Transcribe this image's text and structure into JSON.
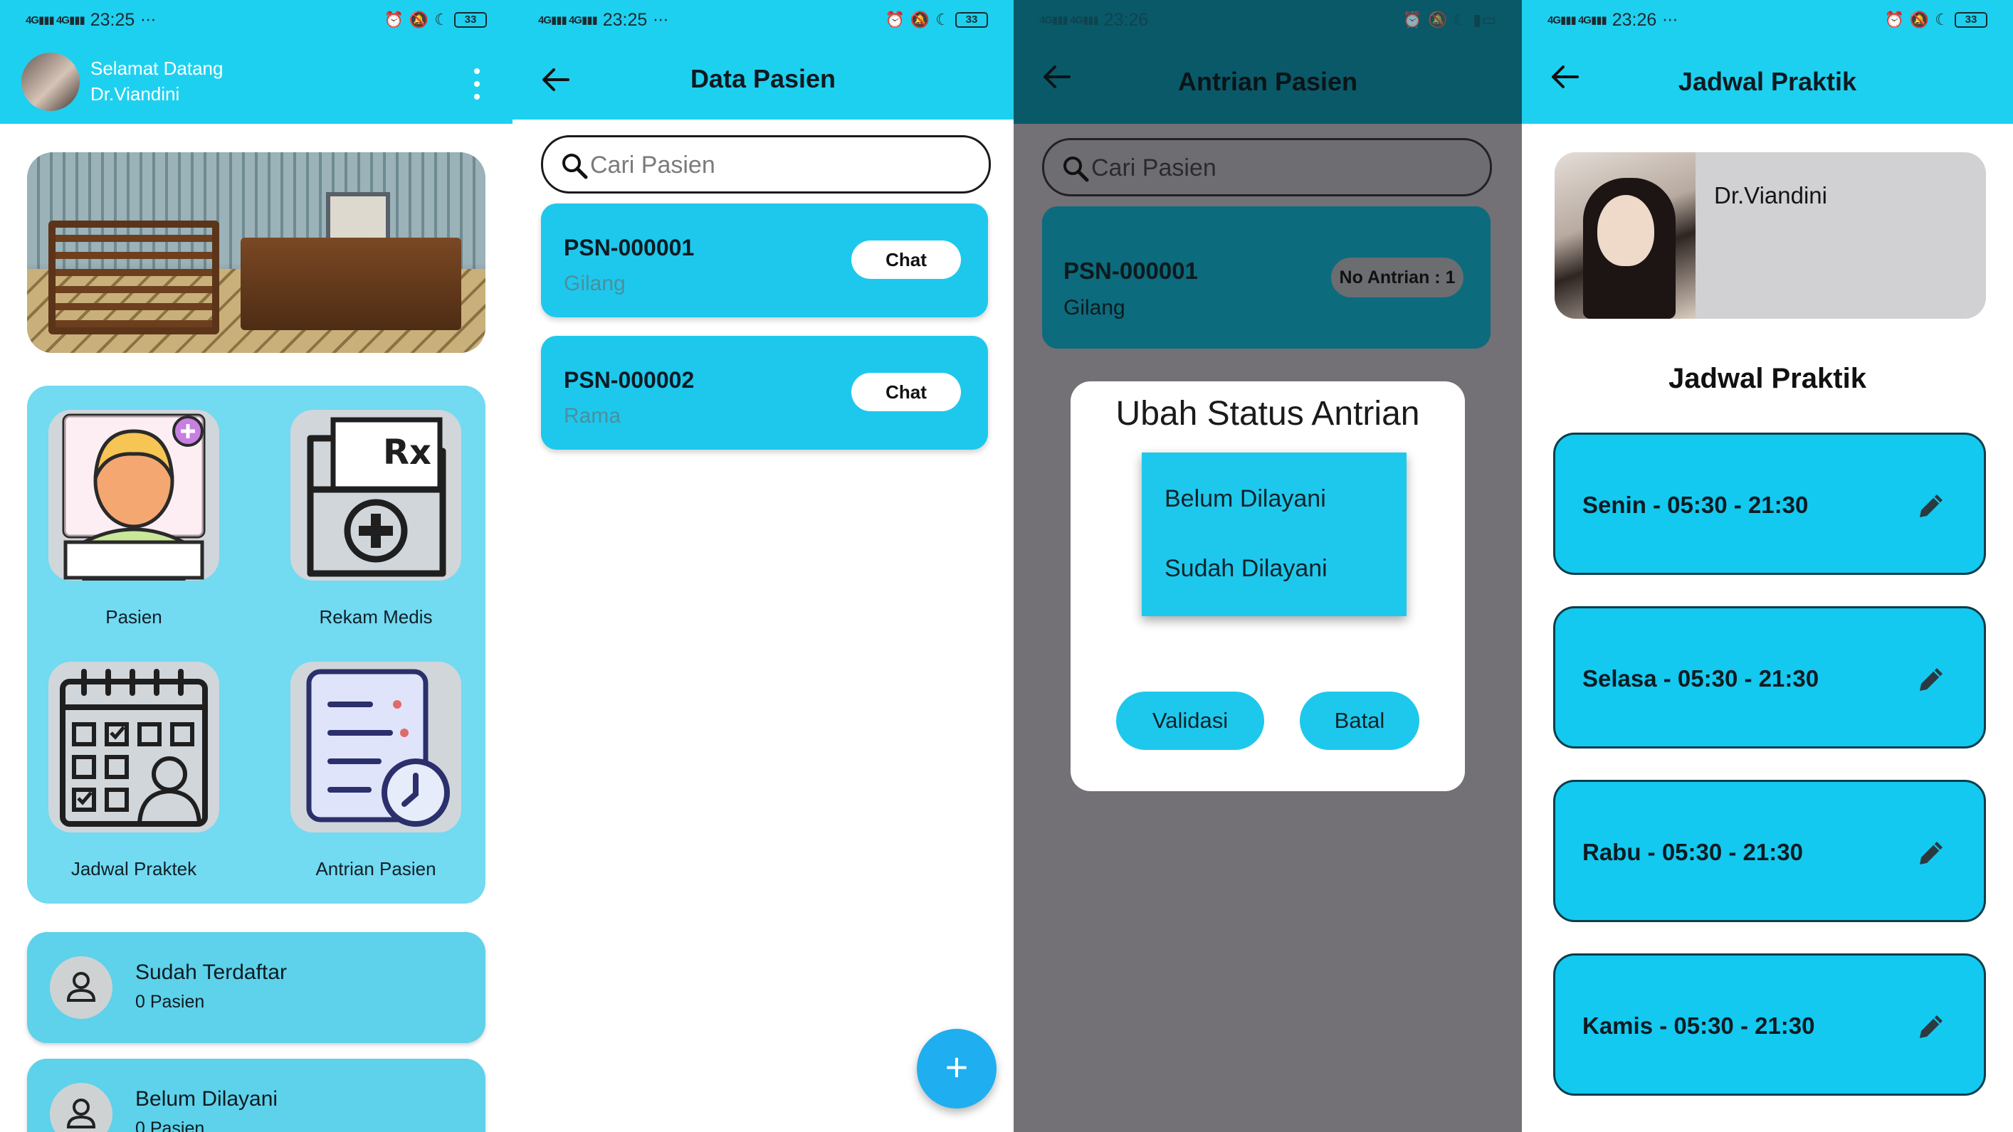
{
  "colors": {
    "primary": "#1ed0ef",
    "card": "#1ec8ec",
    "fab": "#1faef0",
    "overlay": "#737076"
  },
  "status_bars": [
    {
      "time": "23:25",
      "battery": "33"
    },
    {
      "time": "23:25",
      "battery": "33"
    },
    {
      "time": "23:26",
      "battery": ""
    },
    {
      "time": "23:26",
      "battery": "33"
    }
  ],
  "home": {
    "welcome_line1": "Selamat Datang",
    "welcome_line2": "Dr.Viandini",
    "menu": [
      {
        "label": "Pasien",
        "icon": "patient-icon"
      },
      {
        "label": "Rekam Medis",
        "icon": "medical-record-folder-icon"
      },
      {
        "label": "Jadwal Praktek",
        "icon": "calendar-doctor-icon"
      },
      {
        "label": "Antrian Pasien",
        "icon": "queue-clipboard-clock-icon"
      }
    ],
    "stats": [
      {
        "title": "Sudah Terdaftar",
        "subtitle": "0 Pasien"
      },
      {
        "title": "Belum Dilayani",
        "subtitle": "0 Pasien"
      }
    ]
  },
  "data_pasien": {
    "title": "Data Pasien",
    "search_placeholder": "Cari Pasien",
    "patients": [
      {
        "id": "PSN-000001",
        "name": "Gilang",
        "action": "Chat"
      },
      {
        "id": "PSN-000002",
        "name": "Rama",
        "action": "Chat"
      }
    ],
    "fab": "+"
  },
  "antrian": {
    "title": "Antrian Pasien",
    "search_placeholder": "Cari Pasien",
    "entry": {
      "id": "PSN-000001",
      "name": "Gilang",
      "badge": "No Antrian : 1"
    },
    "dialog": {
      "title": "Ubah Status Antrian",
      "options": [
        "Belum Dilayani",
        "Sudah Dilayani"
      ],
      "confirm": "Validasi",
      "cancel": "Batal"
    }
  },
  "jadwal": {
    "title": "Jadwal Praktik",
    "doctor_name": "Dr.Viandini",
    "section_title": "Jadwal Praktik",
    "schedules": [
      "Senin - 05:30 - 21:30",
      "Selasa - 05:30 - 21:30",
      "Rabu - 05:30 - 21:30",
      "Kamis - 05:30 - 21:30"
    ]
  }
}
